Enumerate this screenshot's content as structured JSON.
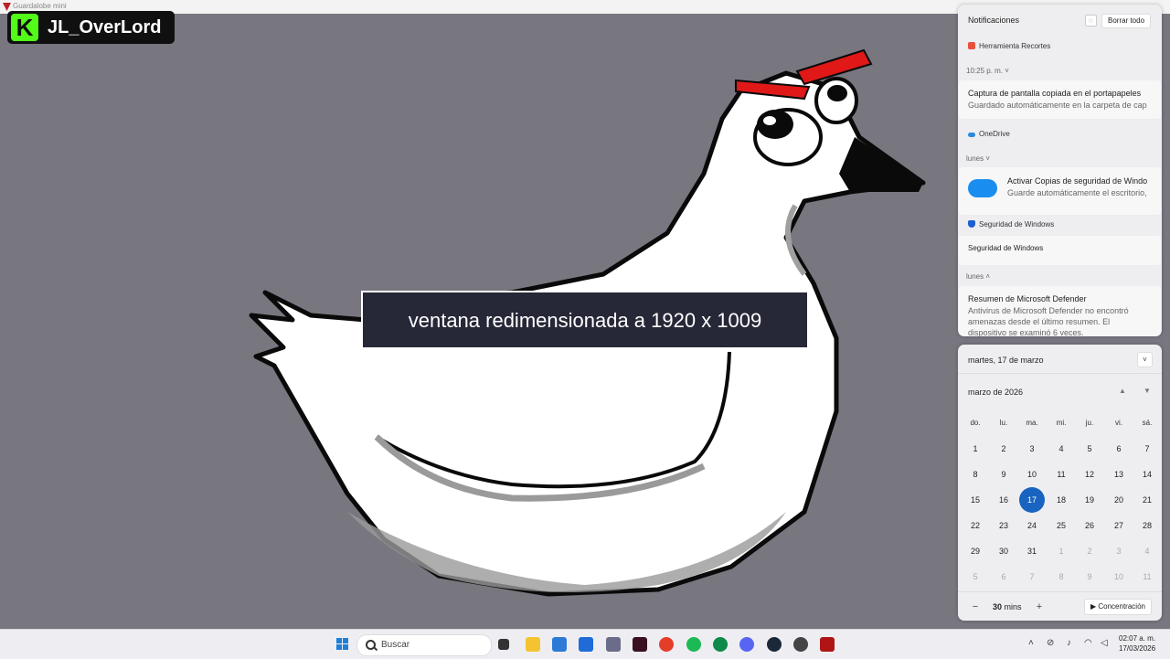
{
  "window": {
    "title": "Guardalobe mini"
  },
  "stream": {
    "channel_name": "JL_OverLord",
    "overlay_text": "ventana redimensionada a 1920 x 1009"
  },
  "notifications": {
    "header": "Notificaciones",
    "clear_all": "Borrar todo",
    "groups": [
      {
        "app": "Herramienta Recortes",
        "time": "10:25 p. m.",
        "title": "Captura de pantalla copiada en el portapapeles",
        "body": "Guardado automáticamente en la carpeta de cap"
      },
      {
        "app": "OneDrive",
        "time": "lunes",
        "title": "Activar Copias de seguridad de Windo",
        "body": "Guarde automáticamente el escritorio,"
      },
      {
        "app": "Seguridad de Windows",
        "title": "Seguridad de Windows",
        "time": "lunes",
        "title2": "Resumen de Microsoft Defender",
        "body_lines": [
          "Antivirus de Microsoft Defender no encontró",
          "amenazas desde el último resumen. El",
          "dispositivo se examinó 6 veces."
        ]
      }
    ]
  },
  "calendar": {
    "date_header": "martes, 17 de marzo",
    "month_label": "marzo de 2026",
    "weekdays": [
      "do.",
      "lu.",
      "ma.",
      "mi.",
      "ju.",
      "vi.",
      "sá."
    ],
    "weeks": [
      [
        "1",
        "2",
        "3",
        "4",
        "5",
        "6",
        "7"
      ],
      [
        "8",
        "9",
        "10",
        "11",
        "12",
        "13",
        "14"
      ],
      [
        "15",
        "16",
        "17",
        "18",
        "19",
        "20",
        "21"
      ],
      [
        "22",
        "23",
        "24",
        "25",
        "26",
        "27",
        "28"
      ],
      [
        "29",
        "30",
        "31",
        "1",
        "2",
        "3",
        "4"
      ],
      [
        "5",
        "6",
        "7",
        "8",
        "9",
        "10",
        "11"
      ]
    ],
    "today": "17",
    "focus_minutes": "30",
    "focus_unit": "mins",
    "focus_button": "Concentración"
  },
  "taskbar": {
    "search_placeholder": "Buscar",
    "clock_time": "02:07 a. m.",
    "clock_date": "17/03/2026"
  },
  "colors": {
    "accent": "#1864c0",
    "kick_green": "#53fc18",
    "desktop": "#78767f"
  }
}
